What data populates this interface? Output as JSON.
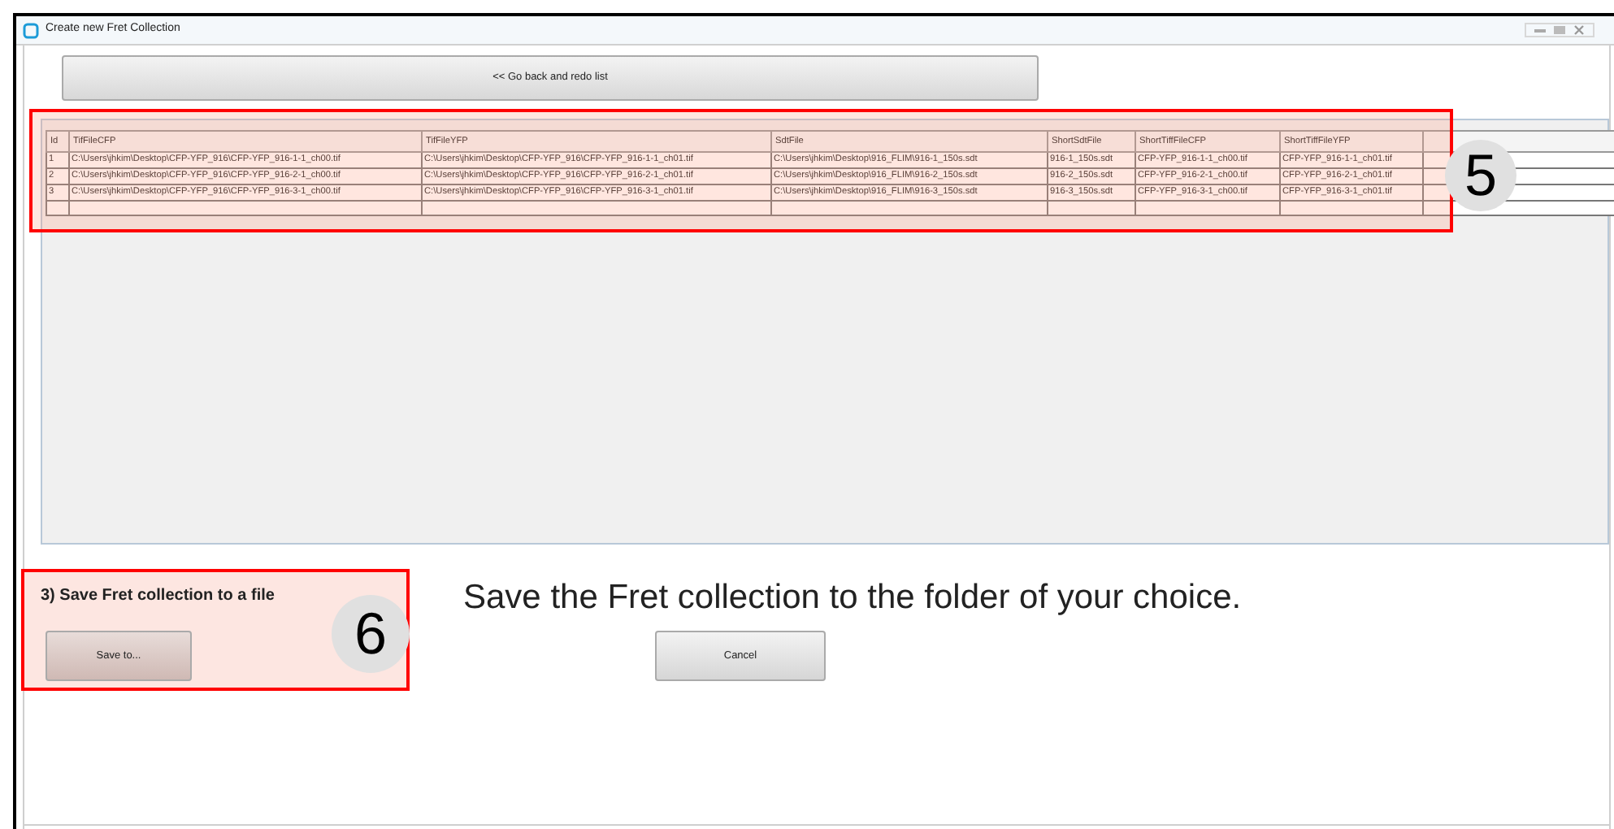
{
  "window": {
    "title": "Create new Fret Collection"
  },
  "back_button": {
    "label": "<< Go back and redo list"
  },
  "table": {
    "columns": [
      "Id",
      "TifFileCFP",
      "TifFileYFP",
      "SdtFile",
      "ShortSdtFile",
      "ShortTiffFileCFP",
      "ShortTiffFileYFP"
    ],
    "rows": [
      [
        "1",
        "C:\\Users\\jhkim\\Desktop\\CFP-YFP_916\\CFP-YFP_916-1-1_ch00.tif",
        "C:\\Users\\jhkim\\Desktop\\CFP-YFP_916\\CFP-YFP_916-1-1_ch01.tif",
        "C:\\Users\\jhkim\\Desktop\\916_FLIM\\916-1_150s.sdt",
        "916-1_150s.sdt",
        "CFP-YFP_916-1-1_ch00.tif",
        "CFP-YFP_916-1-1_ch01.tif"
      ],
      [
        "2",
        "C:\\Users\\jhkim\\Desktop\\CFP-YFP_916\\CFP-YFP_916-2-1_ch00.tif",
        "C:\\Users\\jhkim\\Desktop\\CFP-YFP_916\\CFP-YFP_916-2-1_ch01.tif",
        "C:\\Users\\jhkim\\Desktop\\916_FLIM\\916-2_150s.sdt",
        "916-2_150s.sdt",
        "CFP-YFP_916-2-1_ch00.tif",
        "CFP-YFP_916-2-1_ch01.tif"
      ],
      [
        "3",
        "C:\\Users\\jhkim\\Desktop\\CFP-YFP_916\\CFP-YFP_916-3-1_ch00.tif",
        "C:\\Users\\jhkim\\Desktop\\CFP-YFP_916\\CFP-YFP_916-3-1_ch01.tif",
        "C:\\Users\\jhkim\\Desktop\\916_FLIM\\916-3_150s.sdt",
        "916-3_150s.sdt",
        "CFP-YFP_916-3-1_ch00.tif",
        "CFP-YFP_916-3-1_ch01.tif"
      ]
    ]
  },
  "save_section": {
    "heading": "3) Save Fret collection to a file",
    "button": "Save to..."
  },
  "instruction": "Save the Fret collection to the folder of your choice.",
  "cancel_button": "Cancel",
  "annotations": [
    "5",
    "6"
  ]
}
